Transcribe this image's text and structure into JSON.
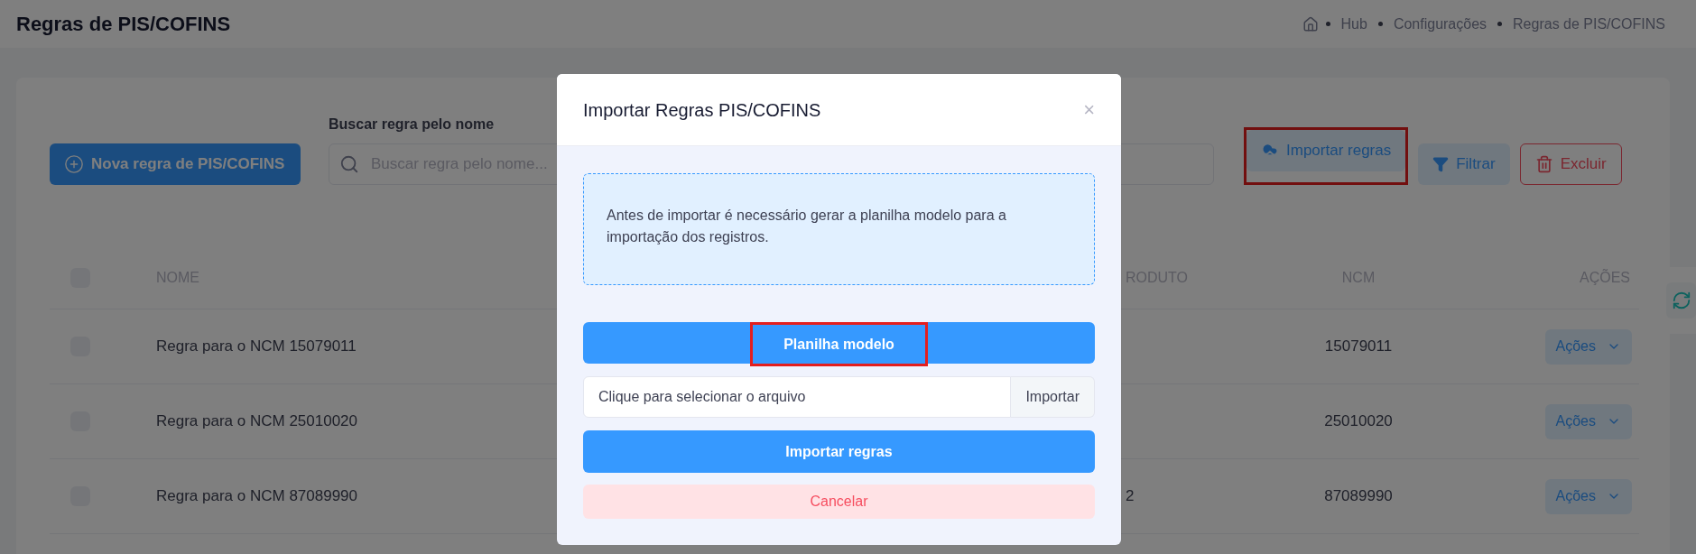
{
  "header": {
    "title": "Regras de PIS/COFINS",
    "breadcrumb": [
      {
        "label": "Hub"
      },
      {
        "label": "Configurações"
      },
      {
        "label": "Regras de PIS/COFINS"
      }
    ]
  },
  "toolbar": {
    "new_button": "Nova regra de PIS/COFINS",
    "search": {
      "label": "Buscar regra pelo nome",
      "placeholder": "Buscar regra pelo nome..."
    },
    "actions": [
      {
        "kind": "import",
        "label": "Importar regras",
        "highlighted": true
      },
      {
        "kind": "filter",
        "label": "Filtrar",
        "highlighted": false
      },
      {
        "kind": "delete",
        "label": "Excluir",
        "highlighted": false
      }
    ]
  },
  "table": {
    "select_all": {
      "checked": false
    },
    "columns": [
      "NOME",
      "RODUTO",
      "NCM",
      "AÇÕES"
    ],
    "rows": [
      {
        "checked": false,
        "name": "Regra para o NCM 15079011",
        "ncm": "15079011",
        "action": "Ações"
      },
      {
        "checked": false,
        "name": "Regra para o NCM 25010020",
        "ncm": "25010020",
        "action": "Ações"
      },
      {
        "checked": false,
        "name": "Regra para o NCM 87089990",
        "column_3": "2",
        "ncm": "87089990",
        "action": "Ações"
      }
    ]
  },
  "modal": {
    "title": "Importar Regras PIS/COFINS",
    "close": "×",
    "notice": "Antes de importar é necessário gerar a planilha modelo para a importação dos registros.",
    "template_button": {
      "label": "Planilha modelo",
      "highlighted": true
    },
    "file": {
      "placeholder": "Clique para selecionar o arquivo",
      "button": "Importar"
    },
    "submit": "Importar regras",
    "cancel": "Cancelar"
  }
}
